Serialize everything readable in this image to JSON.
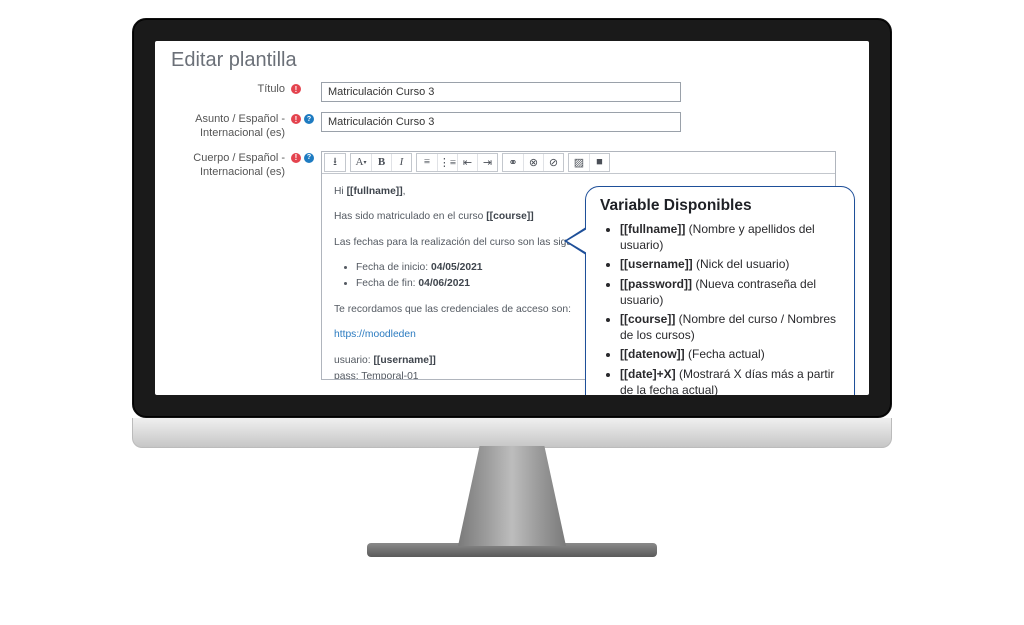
{
  "page": {
    "title": "Editar plantilla"
  },
  "fields": {
    "title_label": "Título",
    "title_value": "Matriculación Curso 3",
    "subject_label": "Asunto / Español - Internacional (es)",
    "subject_value": "Matriculación Curso 3",
    "body_label": "Cuerpo / Español - Internacional (es)"
  },
  "toolbar": {
    "expand": "⭳",
    "astyle": "A",
    "bold": "B",
    "italic": "I",
    "list_bullet": "≡",
    "list_num": "⋮≡",
    "outdent": "⇤",
    "indent": "⇥",
    "link": "⚭",
    "unlink": "⊗",
    "nolink": "⊘",
    "image": "▨",
    "media": "■"
  },
  "body": {
    "line1_pre": "Hi ",
    "line1_var": "[[fullname]]",
    "line1_post": ",",
    "line2_pre": "Has sido matriculado en el curso ",
    "line2_var": "[[course]]",
    "line3": "Las fechas para la realización del curso son las siguientes:",
    "bullet1_pre": "Fecha de inicio: ",
    "bullet1_val": "04/05/2021",
    "bullet2_pre": "Fecha de fin: ",
    "bullet2_val": "04/06/2021",
    "line4": "Te recordamos que las credenciales de acceso son:",
    "link": "https://moodleden",
    "user_pre": "usuario: ",
    "user_var": "[[username]]",
    "pass_pre": "pass: ",
    "pass_val": "Temporal-01"
  },
  "popup": {
    "title": "Variable Disponibles",
    "items": [
      {
        "var": "[[fullname]]",
        "desc": " (Nombre y apellidos del usuario)"
      },
      {
        "var": "[[username]]",
        "desc": " (Nick del usuario)"
      },
      {
        "var": "[[password]]",
        "desc": " (Nueva contraseña del usuario)"
      },
      {
        "var": "[[course]]",
        "desc": " (Nombre del curso / Nombres de los cursos)"
      },
      {
        "var": "[[datenow]]",
        "desc": " (Fecha actual)"
      },
      {
        "var": "[[date]+X]",
        "desc": " (Mostrará X días más a partir de la fecha actual)"
      }
    ]
  }
}
